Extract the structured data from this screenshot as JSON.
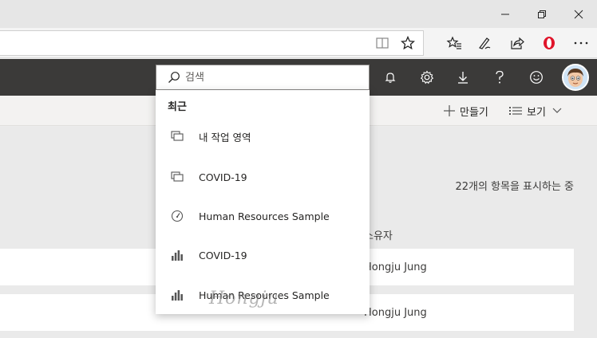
{
  "browser": {
    "window_controls": [
      "minimize",
      "restore",
      "close"
    ],
    "toolbar_icons": [
      "reading-view-icon",
      "favorite-star-icon",
      "favorites-hub-icon",
      "pen-icon",
      "share-icon",
      "opera-icon",
      "more-icon"
    ]
  },
  "header": {
    "search_placeholder": "검색",
    "icons": [
      "bell-icon",
      "gear-icon",
      "download-icon",
      "help-icon",
      "smiley-icon"
    ]
  },
  "command_bar": {
    "create_label": "만들기",
    "view_label": "보기"
  },
  "content": {
    "item_count_label": "22개의 항목을 표시하는 중",
    "owner_column_label": "소유자",
    "rows": [
      {
        "owner": "Hongju Jung"
      },
      {
        "owner": "Hongju Jung"
      }
    ]
  },
  "search_dropdown": {
    "heading": "최근",
    "items": [
      {
        "label": "내 작업 영역",
        "icon": "workspace-icon"
      },
      {
        "label": "COVID-19",
        "icon": "workspace-icon"
      },
      {
        "label": "Human Resources Sample",
        "icon": "dashboard-gauge-icon"
      },
      {
        "label": "COVID-19",
        "icon": "report-bar-chart-icon"
      },
      {
        "label": "Human Resources Sample",
        "icon": "report-bar-chart-icon"
      }
    ]
  },
  "watermark": "Hongju"
}
